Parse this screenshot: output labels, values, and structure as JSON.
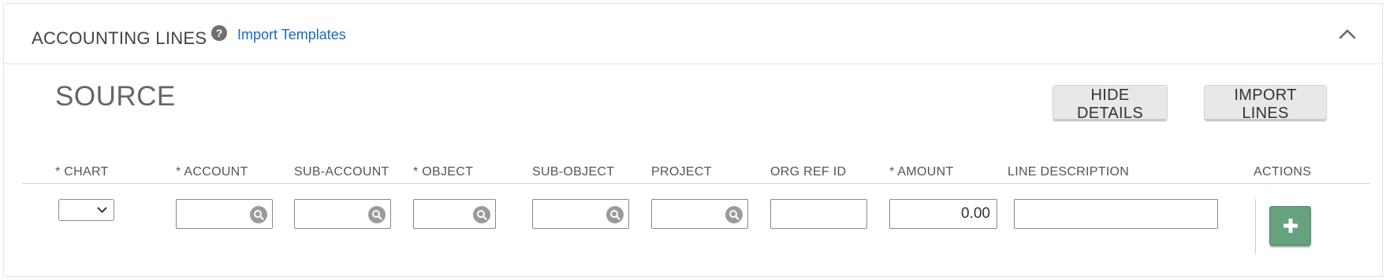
{
  "header": {
    "title": "ACCOUNTING LINES",
    "help_glyph": "?",
    "import_templates_label": "Import Templates"
  },
  "section": {
    "title": "SOURCE",
    "hide_details_label": "HIDE DETAILS",
    "import_lines_label": "IMPORT LINES"
  },
  "columns": {
    "chart": "* CHART",
    "account": "* ACCOUNT",
    "sub_account": "SUB-ACCOUNT",
    "object": "* OBJECT",
    "sub_object": "SUB-OBJECT",
    "project": "PROJECT",
    "org_ref_id": "ORG REF ID",
    "amount": "* AMOUNT",
    "line_description": "LINE DESCRIPTION",
    "actions": "ACTIONS"
  },
  "row": {
    "chart_value": "",
    "account_value": "",
    "sub_account_value": "",
    "object_value": "",
    "sub_object_value": "",
    "project_value": "",
    "org_ref_id_value": "",
    "amount_value": "0.00",
    "line_description_value": ""
  },
  "icons": {
    "help": "help-icon",
    "collapse": "chevron-up-icon",
    "lookup": "search-icon",
    "dropdown": "chevron-down-icon",
    "add": "plus-icon"
  },
  "colors": {
    "link": "#1a67c2",
    "add_button": "#66a27d",
    "lookup_icon": "#9a9a9a"
  }
}
